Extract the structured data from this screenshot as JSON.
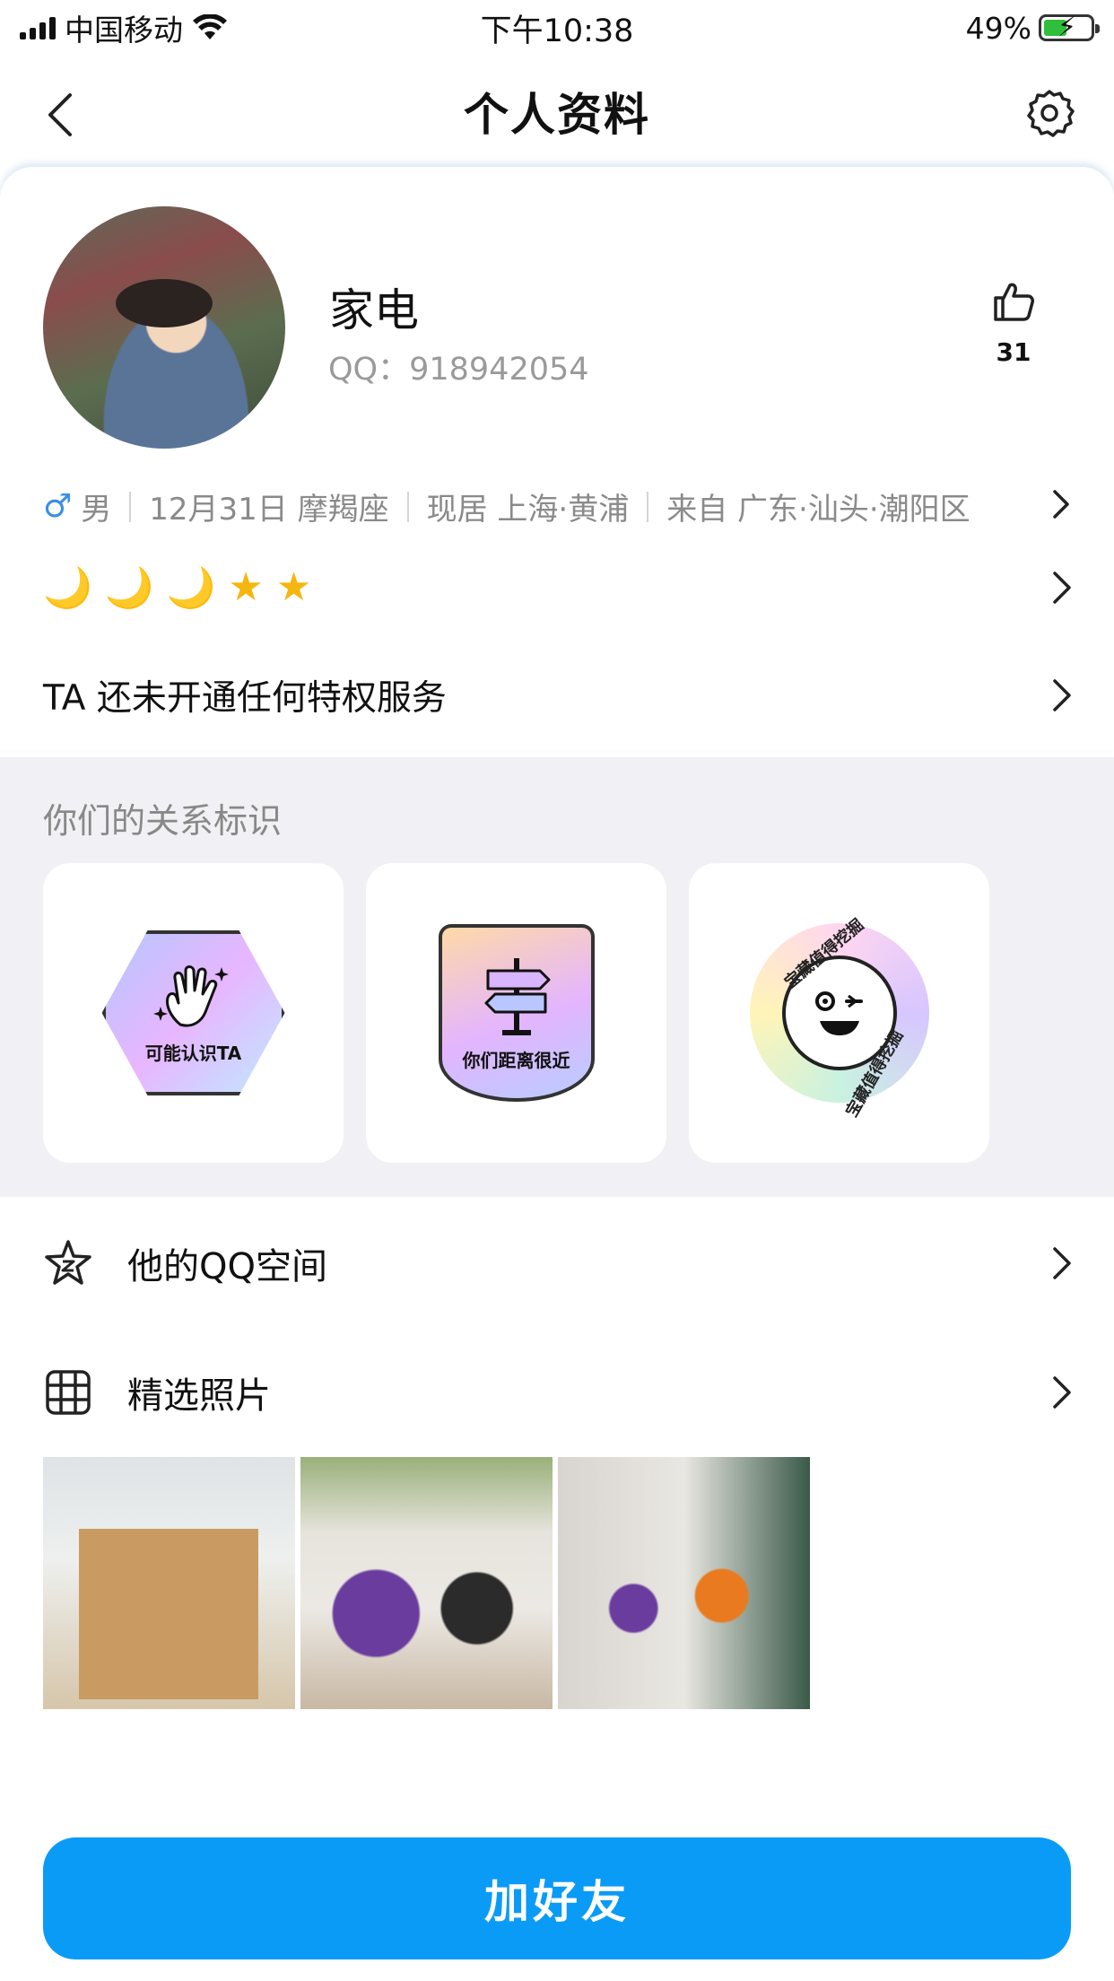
{
  "status_bar": {
    "carrier": "中国移动",
    "time": "下午10:38",
    "battery": "49%"
  },
  "nav": {
    "title": "个人资料"
  },
  "profile": {
    "nickname": "家电",
    "qq_label": "QQ：",
    "qq_number": "918942054",
    "like_count": "31"
  },
  "info": {
    "gender_symbol": "♂",
    "gender": "男",
    "birthday": "12月31日 摩羯座",
    "residence": "现居 上海·黄浦",
    "hometown": "来自 广东·汕头·潮阳区"
  },
  "level": {
    "icons": [
      "moon",
      "moon",
      "moon",
      "star",
      "star"
    ]
  },
  "privilege": {
    "text": "TA 还未开通任何特权服务"
  },
  "relationship": {
    "title": "你们的关系标识",
    "badges": [
      {
        "label": "可能认识TA",
        "icon": "waving-hand-icon"
      },
      {
        "label": "你们距离很近",
        "icon": "signpost-icon"
      },
      {
        "label": "宝藏值得挖掘",
        "icon": "smiley-face-icon"
      }
    ]
  },
  "rows": {
    "qzone": "他的QQ空间",
    "photos": "精选照片"
  },
  "add_friend": {
    "label": "加好友"
  },
  "colors": {
    "accent": "#0a9bf6",
    "male": "#3a8ee6",
    "star": "#f5b60f",
    "section_bg": "#f1f1f5"
  }
}
